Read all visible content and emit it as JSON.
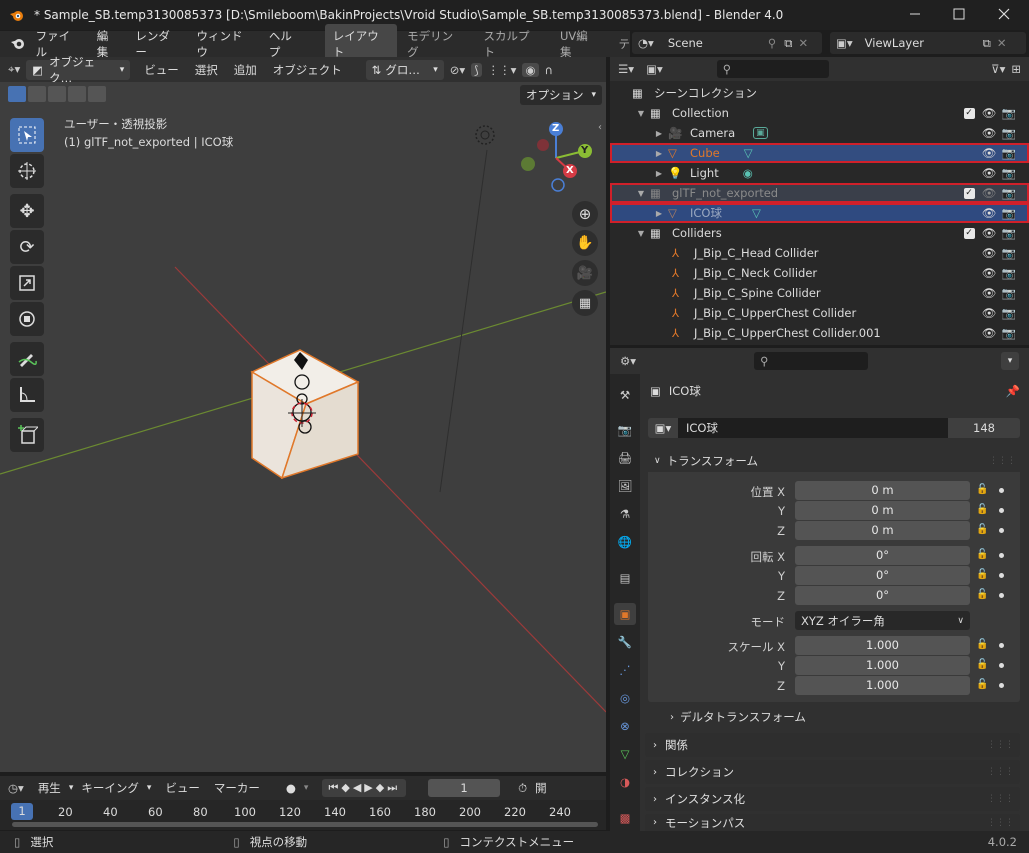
{
  "titlebar": {
    "title": "* Sample_SB.temp3130085373 [D:\\Smileboom\\BakinProjects\\Vroid Studio\\Sample_SB.temp3130085373.blend] - Blender 4.0"
  },
  "menu": {
    "items": [
      "ファイル",
      "編集",
      "レンダー",
      "ウィンドウ",
      "ヘルプ"
    ],
    "workspaces": [
      "レイアウト",
      "モデリング",
      "スカルプト",
      "UV編集",
      "テ"
    ]
  },
  "scene": {
    "name": "Scene",
    "view_layer": "ViewLayer"
  },
  "viewport_header": {
    "mode": "オブジェク…",
    "items": [
      "ビュー",
      "選択",
      "追加",
      "オブジェクト"
    ],
    "orientation": "グロ…",
    "options": "オプション"
  },
  "viewport": {
    "view_name": "ユーザー・透視投影",
    "selected_info": "(1) glTF_not_exported | ICO球",
    "gizmo": {
      "x": "X",
      "y": "Y",
      "z": "Z"
    }
  },
  "outliner": {
    "scene_collection": "シーンコレクション",
    "rows": [
      {
        "label": "Collection"
      },
      {
        "label": "Camera"
      },
      {
        "label": "Cube"
      },
      {
        "label": "Light"
      },
      {
        "label": "glTF_not_exported"
      },
      {
        "label": "ICO球"
      },
      {
        "label": "Colliders"
      },
      {
        "label": "J_Bip_C_Head Collider"
      },
      {
        "label": "J_Bip_C_Neck Collider"
      },
      {
        "label": "J_Bip_C_Spine Collider"
      },
      {
        "label": "J_Bip_C_UpperChest Collider"
      },
      {
        "label": "J_Bip_C_UpperChest Collider.001"
      }
    ]
  },
  "properties": {
    "object_name": "ICO球",
    "mesh_name": "ICO球",
    "mesh_users": "148",
    "transform_label": "トランスフォーム",
    "location_label": "位置 X",
    "location": [
      "0 m",
      "0 m",
      "0 m"
    ],
    "rotation_label": "回転 X",
    "rotation": [
      "0°",
      "0°",
      "0°"
    ],
    "mode_label": "モード",
    "mode_value": "XYZ オイラー角",
    "scale_label": "スケール X",
    "scale": [
      "1.000",
      "1.000",
      "1.000"
    ],
    "axis_y": "Y",
    "axis_z": "Z",
    "delta": "デルタトランスフォーム",
    "panels": [
      "関係",
      "コレクション",
      "インスタンス化",
      "モーションパス"
    ]
  },
  "timeline": {
    "playback": "再生",
    "keying": "キーイング",
    "view": "ビュー",
    "marker": "マーカー",
    "frame": "1",
    "start_label": "開",
    "ruler": [
      "1",
      "20",
      "40",
      "60",
      "80",
      "100",
      "120",
      "140",
      "160",
      "180",
      "200",
      "220",
      "240"
    ]
  },
  "statusbar": {
    "select": "選択",
    "move_view": "視点の移動",
    "context_menu": "コンテクストメニュー",
    "version": "4.0.2"
  },
  "colors": {
    "accent": "#4772b3",
    "red_box": "#d0202a",
    "orange": "#e0782a"
  }
}
